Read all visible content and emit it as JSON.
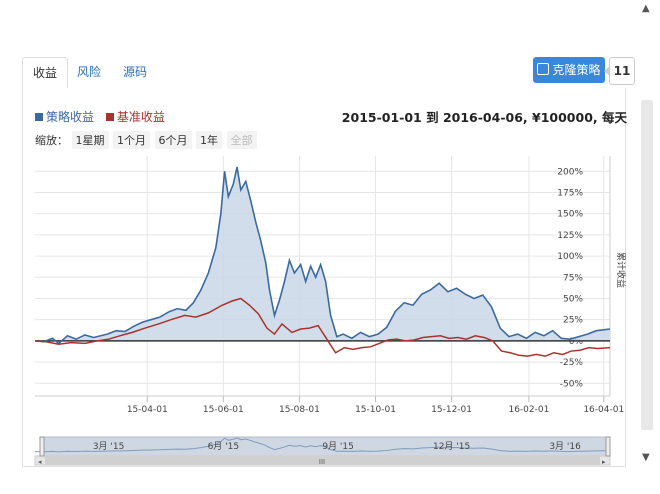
{
  "tabs": [
    {
      "label": "收益",
      "active": true
    },
    {
      "label": "风险",
      "active": false
    },
    {
      "label": "源码",
      "active": false
    }
  ],
  "clone_button": {
    "label": "克隆策略",
    "count": "11"
  },
  "legend": [
    {
      "label": "策略收益",
      "color": "#3b6aa0"
    },
    {
      "label": "基准收益",
      "color": "#a8332d"
    }
  ],
  "range_text": "2015-01-01 到 2016-04-06, ¥100000, 每天",
  "zoom": {
    "label": "缩放：",
    "buttons": [
      {
        "label": "1星期",
        "enabled": true
      },
      {
        "label": "1个月",
        "enabled": true
      },
      {
        "label": "6个月",
        "enabled": true
      },
      {
        "label": "1年",
        "enabled": true
      },
      {
        "label": "全部",
        "enabled": false
      }
    ]
  },
  "chart_data": {
    "type": "line",
    "ylabel": "累计收益",
    "ylim": [
      -50,
      200
    ],
    "yticks": [
      "200%",
      "175%",
      "150%",
      "125%",
      "100%",
      "75%",
      "50%",
      "25%",
      "0%",
      "-25%",
      "-50%"
    ],
    "ytick_values": [
      200,
      175,
      150,
      125,
      100,
      75,
      50,
      25,
      0,
      -25,
      -50
    ],
    "xticks": [
      "15-04-01",
      "15-06-01",
      "15-08-01",
      "15-10-01",
      "15-12-01",
      "16-02-01",
      "16-04-01"
    ],
    "xtick_values": [
      "2015-04-01",
      "2015-06-01",
      "2015-08-01",
      "2015-10-01",
      "2015-12-01",
      "2016-02-01",
      "2016-04-01"
    ],
    "x_range": [
      "2015-01-01",
      "2016-04-06"
    ],
    "grid": true,
    "series": [
      {
        "name": "策略收益",
        "color": "#3b6aa0",
        "fill": "#c9d7e6",
        "points": [
          [
            "2015-01-01",
            0
          ],
          [
            "2015-01-08",
            -1
          ],
          [
            "2015-01-15",
            3
          ],
          [
            "2015-01-20",
            -3
          ],
          [
            "2015-01-27",
            6
          ],
          [
            "2015-02-03",
            2
          ],
          [
            "2015-02-10",
            7
          ],
          [
            "2015-02-17",
            4
          ],
          [
            "2015-02-28",
            8
          ],
          [
            "2015-03-07",
            12
          ],
          [
            "2015-03-14",
            11
          ],
          [
            "2015-03-21",
            17
          ],
          [
            "2015-03-28",
            22
          ],
          [
            "2015-04-04",
            25
          ],
          [
            "2015-04-11",
            28
          ],
          [
            "2015-04-18",
            34
          ],
          [
            "2015-04-25",
            38
          ],
          [
            "2015-05-02",
            36
          ],
          [
            "2015-05-08",
            45
          ],
          [
            "2015-05-14",
            60
          ],
          [
            "2015-05-20",
            80
          ],
          [
            "2015-05-26",
            110
          ],
          [
            "2015-05-30",
            150
          ],
          [
            "2015-06-02",
            200
          ],
          [
            "2015-06-05",
            170
          ],
          [
            "2015-06-09",
            185
          ],
          [
            "2015-06-12",
            205
          ],
          [
            "2015-06-15",
            178
          ],
          [
            "2015-06-19",
            188
          ],
          [
            "2015-06-23",
            165
          ],
          [
            "2015-06-27",
            140
          ],
          [
            "2015-07-01",
            118
          ],
          [
            "2015-07-05",
            92
          ],
          [
            "2015-07-08",
            60
          ],
          [
            "2015-07-12",
            30
          ],
          [
            "2015-07-16",
            48
          ],
          [
            "2015-07-20",
            70
          ],
          [
            "2015-07-24",
            95
          ],
          [
            "2015-07-28",
            80
          ],
          [
            "2015-08-02",
            90
          ],
          [
            "2015-08-06",
            70
          ],
          [
            "2015-08-10",
            88
          ],
          [
            "2015-08-14",
            75
          ],
          [
            "2015-08-18",
            90
          ],
          [
            "2015-08-22",
            70
          ],
          [
            "2015-08-26",
            30
          ],
          [
            "2015-08-31",
            5
          ],
          [
            "2015-09-05",
            8
          ],
          [
            "2015-09-12",
            3
          ],
          [
            "2015-09-19",
            10
          ],
          [
            "2015-09-26",
            5
          ],
          [
            "2015-10-03",
            8
          ],
          [
            "2015-10-10",
            16
          ],
          [
            "2015-10-17",
            35
          ],
          [
            "2015-10-24",
            45
          ],
          [
            "2015-10-31",
            42
          ],
          [
            "2015-11-07",
            55
          ],
          [
            "2015-11-14",
            60
          ],
          [
            "2015-11-21",
            68
          ],
          [
            "2015-11-28",
            58
          ],
          [
            "2015-12-05",
            62
          ],
          [
            "2015-12-12",
            55
          ],
          [
            "2015-12-19",
            50
          ],
          [
            "2015-12-26",
            54
          ],
          [
            "2016-01-02",
            40
          ],
          [
            "2016-01-09",
            15
          ],
          [
            "2016-01-16",
            5
          ],
          [
            "2016-01-23",
            8
          ],
          [
            "2016-01-30",
            3
          ],
          [
            "2016-02-06",
            10
          ],
          [
            "2016-02-13",
            6
          ],
          [
            "2016-02-20",
            12
          ],
          [
            "2016-02-27",
            3
          ],
          [
            "2016-03-05",
            2
          ],
          [
            "2016-03-12",
            5
          ],
          [
            "2016-03-19",
            8
          ],
          [
            "2016-03-26",
            12
          ],
          [
            "2016-04-06",
            14
          ]
        ]
      },
      {
        "name": "基准收益",
        "color": "#a8332d",
        "points": [
          [
            "2015-01-01",
            0
          ],
          [
            "2015-01-10",
            -1
          ],
          [
            "2015-01-20",
            -4
          ],
          [
            "2015-01-30",
            -2
          ],
          [
            "2015-02-10",
            -3
          ],
          [
            "2015-02-20",
            0
          ],
          [
            "2015-03-01",
            2
          ],
          [
            "2015-03-10",
            6
          ],
          [
            "2015-03-20",
            10
          ],
          [
            "2015-03-30",
            15
          ],
          [
            "2015-04-10",
            20
          ],
          [
            "2015-04-20",
            25
          ],
          [
            "2015-05-01",
            30
          ],
          [
            "2015-05-10",
            28
          ],
          [
            "2015-05-20",
            33
          ],
          [
            "2015-05-31",
            42
          ],
          [
            "2015-06-08",
            47
          ],
          [
            "2015-06-15",
            50
          ],
          [
            "2015-06-22",
            42
          ],
          [
            "2015-06-29",
            32
          ],
          [
            "2015-07-06",
            15
          ],
          [
            "2015-07-12",
            8
          ],
          [
            "2015-07-18",
            20
          ],
          [
            "2015-07-26",
            10
          ],
          [
            "2015-08-02",
            14
          ],
          [
            "2015-08-09",
            15
          ],
          [
            "2015-08-16",
            18
          ],
          [
            "2015-08-23",
            2
          ],
          [
            "2015-08-30",
            -14
          ],
          [
            "2015-09-06",
            -8
          ],
          [
            "2015-09-13",
            -10
          ],
          [
            "2015-09-20",
            -8
          ],
          [
            "2015-09-27",
            -7
          ],
          [
            "2015-10-04",
            -3
          ],
          [
            "2015-10-11",
            1
          ],
          [
            "2015-10-18",
            2
          ],
          [
            "2015-10-25",
            0
          ],
          [
            "2015-11-01",
            1
          ],
          [
            "2015-11-08",
            4
          ],
          [
            "2015-11-15",
            5
          ],
          [
            "2015-11-22",
            6
          ],
          [
            "2015-11-29",
            3
          ],
          [
            "2015-12-06",
            4
          ],
          [
            "2015-12-13",
            2
          ],
          [
            "2015-12-20",
            6
          ],
          [
            "2015-12-27",
            4
          ],
          [
            "2016-01-03",
            0
          ],
          [
            "2016-01-10",
            -12
          ],
          [
            "2016-01-17",
            -14
          ],
          [
            "2016-01-24",
            -17
          ],
          [
            "2016-01-31",
            -18
          ],
          [
            "2016-02-07",
            -16
          ],
          [
            "2016-02-14",
            -18
          ],
          [
            "2016-02-21",
            -14
          ],
          [
            "2016-02-28",
            -16
          ],
          [
            "2016-03-06",
            -12
          ],
          [
            "2016-03-13",
            -11
          ],
          [
            "2016-03-20",
            -8
          ],
          [
            "2016-03-27",
            -9
          ],
          [
            "2016-04-06",
            -8
          ]
        ]
      }
    ],
    "navigator": {
      "labels": [
        "3月 '15",
        "6月 '15",
        "9月 '15",
        "12月 '15",
        "3月 '16"
      ],
      "label_dates": [
        "2015-03-01",
        "2015-06-01",
        "2015-09-01",
        "2015-12-01",
        "2016-03-01"
      ],
      "grip": "III"
    }
  }
}
